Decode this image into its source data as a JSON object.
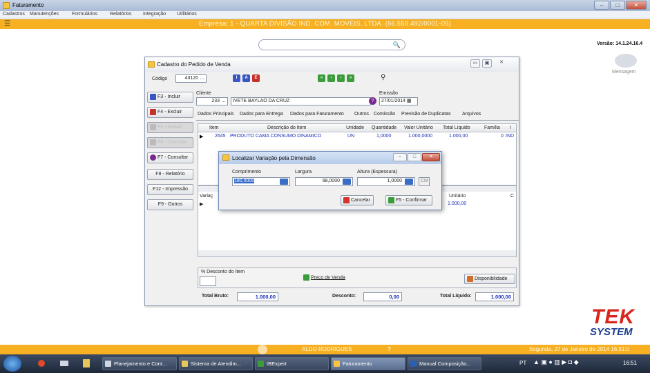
{
  "app": {
    "title": "Faturamento"
  },
  "menu": [
    "Cadastros",
    "Manutenções",
    "Formulários",
    "Relatórios",
    "Integração",
    "Utilitários"
  ],
  "banner": {
    "company": "Empresa: 1 - QUARTA DIVISÃO IND. COM. MOVEIS. LTDA. (66.550.492/0001-05)"
  },
  "header": {
    "version": "Versão: 14.1.24.16.4",
    "messages_label": "Mensagem"
  },
  "pedido": {
    "title": "Cadastro do Pedido de Venda",
    "codigo_label": "Código",
    "codigo_value": "43120",
    "cliente_label": "Cliente",
    "cliente_code": "233",
    "cliente_name": "IVETE BAYLAO DA CRUZ",
    "emissao_label": "Emissão",
    "emissao_value": "27/01/2014",
    "side_buttons": [
      "F3 - Incluir",
      "F4 - Excluir",
      "F5 - Gravar",
      "F6 - Cancelar",
      "F7 - Consultar",
      "F8 - Relatório",
      "F12 - Impressão",
      "F9 - Outros"
    ],
    "tabs": [
      "Dados Principais",
      "Dados para Entrega",
      "Dados para Faturamento",
      "Outros",
      "Comissão",
      "Previsão de Duplicatas",
      "Arquivos"
    ],
    "grid": {
      "headers": [
        "Item",
        "Descrição do Item",
        "Unidade",
        "Quantidade",
        "Valor Unitário",
        "Total Líquido",
        "Família",
        "I"
      ],
      "rows": [
        [
          "2645",
          "PRODUTO CAMA CONSUMO DINAMICO",
          "UN",
          "1,0000",
          "1.000,0000",
          "1.000,00",
          "0",
          "IND"
        ]
      ]
    },
    "grid2": {
      "headers": [
        "Variaç",
        "Unitário",
        "C"
      ],
      "value": "1.000,00"
    },
    "desconto_label": "% Desconto do Item",
    "preco_venda": "Preço de Venda",
    "disponibilidade": "Disponibilidade",
    "totals": {
      "bruto_label": "Total Bruto:",
      "bruto_value": "1.000,00",
      "desconto_label": "Desconto:",
      "desconto_value": "0,00",
      "liquido_label": "Total Líquido:",
      "liquido_value": "1.000,00"
    }
  },
  "dialog": {
    "title": "Localizar Variação pela Dimensão",
    "comprimento_label": "Comprimento",
    "comprimento_value": "180,0000",
    "largura_label": "Largura",
    "largura_value": "98,0000",
    "altura_label": "Altura (Espessura)",
    "altura_value": "1,0000",
    "unit": "CM",
    "cancel": "Cancelar",
    "confirm": "F5 - Confirmar"
  },
  "status": {
    "user": "ALDO RODRIGUES",
    "datetime": "Segunda, 27 de Janeiro de 2014 16:51:0"
  },
  "taskbar": {
    "items": [
      "Planejamento e Cont...",
      "Sistema de Atendim...",
      "IBExpert",
      "Faturamento",
      "Manual Composição..."
    ],
    "lang": "PT",
    "clock": "16:51"
  },
  "logo": {
    "text1": "TEK",
    "text2": "SYSTEM"
  }
}
